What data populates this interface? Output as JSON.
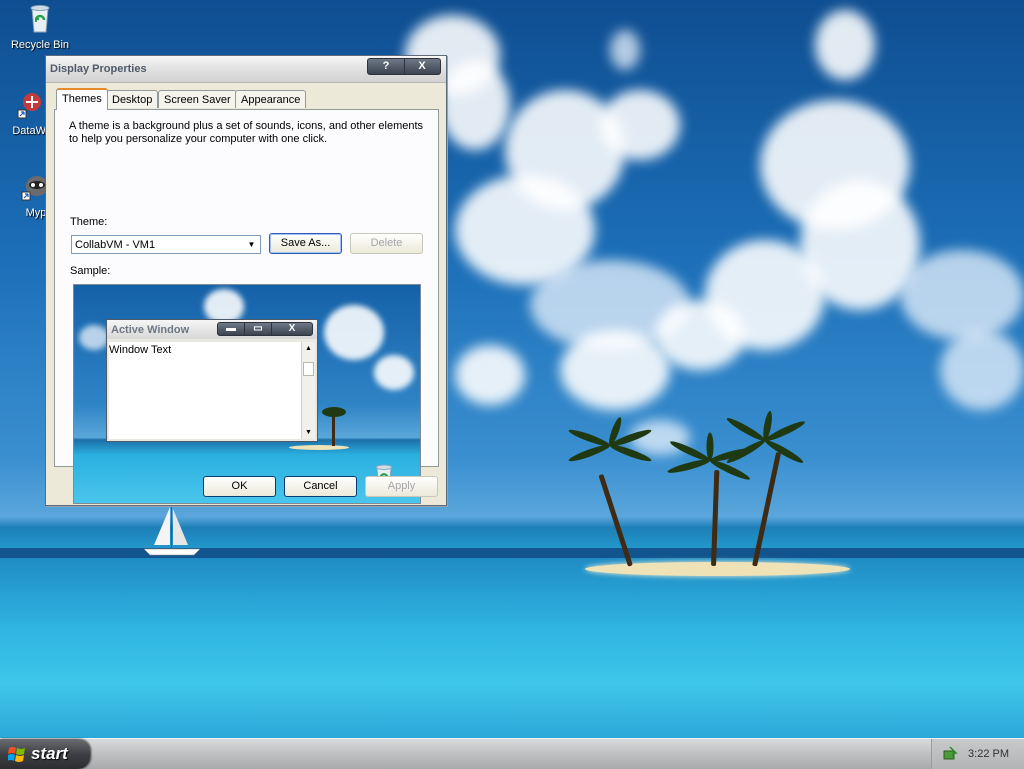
{
  "desktop": {
    "icons": [
      {
        "label": "Recycle Bin"
      },
      {
        "label": "DataWa"
      },
      {
        "label": "Myp"
      }
    ]
  },
  "window": {
    "title": "Display Properties",
    "help_button": "?",
    "close_button": "X",
    "tabs": [
      {
        "label": "Themes",
        "active": true
      },
      {
        "label": "Desktop"
      },
      {
        "label": "Screen Saver"
      },
      {
        "label": "Appearance"
      }
    ],
    "description": "A theme is a background plus a set of sounds, icons, and other elements to help you personalize your computer with one click.",
    "theme_label": "Theme:",
    "theme_value": "CollabVM - VM1",
    "save_as_button": "Save As...",
    "delete_button": "Delete",
    "sample_label": "Sample:",
    "sample": {
      "active_window_title": "Active Window",
      "window_text": "Window Text",
      "minimize": "▬",
      "maximize": "▭",
      "close": "X"
    },
    "ok_button": "OK",
    "cancel_button": "Cancel",
    "apply_button": "Apply"
  },
  "taskbar": {
    "start_label": "start",
    "clock": "3:22 PM"
  },
  "colors": {
    "sky": "#1c6fb8",
    "sea": "#2ab0e0",
    "window_face": "#ece9d8",
    "tab_accent": "#e68b2c"
  }
}
